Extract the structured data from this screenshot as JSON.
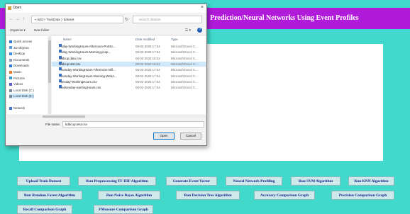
{
  "app": {
    "title": "Prediction/Neural Networks Using Event Profiles",
    "colors": {
      "background": "#40d9cc",
      "title_bar": "#b01ad9",
      "button_text": "#10208a"
    }
  },
  "buttons": [
    "Upload Train Dataset",
    "Run Preprocessing TF-IDF Algorithm",
    "Generate Event Vector",
    "Neural Network Profiling",
    "Run SVM Algorithm",
    "Run KNN Algorithm",
    "Run Random Forest Algorithm",
    "Run Naive Bayes Algorithm",
    "Run Decision Tree Algorithm",
    "Accuracy Comparison Graph",
    "Precision Comparison Graph",
    "Recall Comparison Graph",
    "FMeasure Comparison Graph"
  ],
  "dialog": {
    "title": "Open",
    "close_glyph": "×",
    "address": "« kdd > TrainData > dataset",
    "search_placeholder": "Search dataset",
    "organize_label": "Organize ▾",
    "new_folder_label": "New folder",
    "help_glyph": "?",
    "nav_items": [
      {
        "label": "Quick access",
        "icon": "star-icon",
        "color": "#2f79d8"
      },
      {
        "label": "3D Objects",
        "icon": "cube-icon",
        "color": "#5aa0e0"
      },
      {
        "label": "Desktop",
        "icon": "desktop-icon",
        "color": "#3a8ae0"
      },
      {
        "label": "Documents",
        "icon": "document-icon",
        "color": "#8aa0b8"
      },
      {
        "label": "Downloads",
        "icon": "download-icon",
        "color": "#2f79d8"
      },
      {
        "label": "Music",
        "icon": "music-icon",
        "color": "#e07a2f"
      },
      {
        "label": "Pictures",
        "icon": "picture-icon",
        "color": "#3a9ad0"
      },
      {
        "label": "Videos",
        "icon": "video-icon",
        "color": "#5a5ad0"
      },
      {
        "label": "Local Disk (C:)",
        "icon": "drive-icon",
        "color": "#7a8a9a"
      },
      {
        "label": "Local Disk (E:)",
        "icon": "drive-icon",
        "color": "#7a8a9a",
        "selected": true
      },
      {
        "label": "Network",
        "icon": "network-icon",
        "color": "#3a7ad0"
      }
    ],
    "columns": [
      "Name",
      "Date modified",
      "Type"
    ],
    "files": [
      {
        "name": "Friday-WorkingHours-Afternoon-PortSc...",
        "date": "08-02-2020 17:04",
        "type": "Microsoft Excel C..."
      },
      {
        "name": "Friday-WorkingHours-Morning.pcap...",
        "date": "08-02-2020 17:04",
        "type": "Microsoft Excel C..."
      },
      {
        "name": "kddcup.data.csv",
        "date": "08-02-2020 18:22",
        "type": "Microsoft Excel C..."
      },
      {
        "name": "kddcup.test.csv",
        "date": "08-02-2020 18:22",
        "type": "Microsoft Excel C...",
        "selected": true
      },
      {
        "name": "Thursday-WorkingHours-Afternoon-Infil...",
        "date": "08-02-2020 17:04",
        "type": "Microsoft Excel C..."
      },
      {
        "name": "Thursday-WorkingHours-Morning-WebA...",
        "date": "08-02-2020 17:04",
        "type": "Microsoft Excel C..."
      },
      {
        "name": "Tuesday-WorkingHours.csv",
        "date": "08-02-2020 17:04",
        "type": "Microsoft Excel C..."
      },
      {
        "name": "Wednesday-workingHours.csv",
        "date": "08-02-2020 17:04",
        "type": "Microsoft Excel C..."
      }
    ],
    "filename_label": "File name:",
    "filename_value": "kddcup.test.csv",
    "open_label": "Open",
    "cancel_label": "Cancel"
  }
}
